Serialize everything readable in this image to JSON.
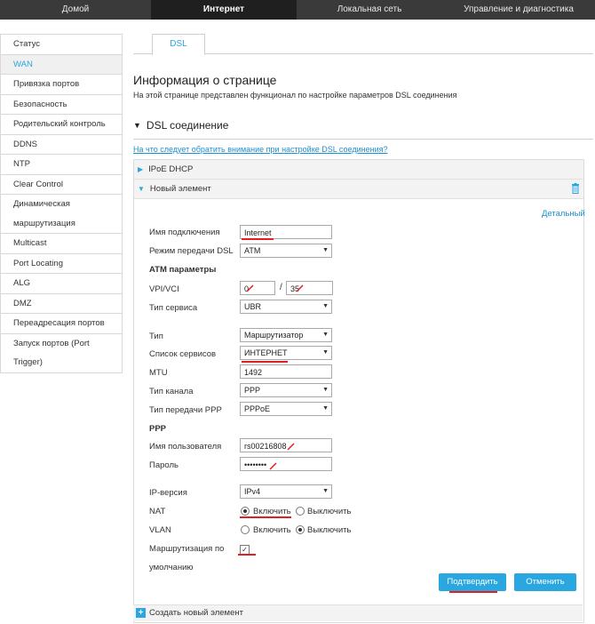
{
  "topnav": [
    "Домой",
    "Интернет",
    "Локальная сеть",
    "Управление и диагностика"
  ],
  "sidebar": [
    "Статус",
    "WAN",
    "Привязка портов",
    "Безопасность",
    "Родительский контроль",
    "DDNS",
    "NTP",
    "Clear Control",
    "Динамическая",
    "маршрутизация",
    "Multicast",
    "Port Locating",
    "ALG",
    "DMZ",
    "Переадресация портов",
    "Запуск портов (Port",
    "Trigger)"
  ],
  "tab": "DSL",
  "page": {
    "title": "Информация о странице",
    "desc": "На этой странице представлен функционал по настройке параметров DSL соединения"
  },
  "section": {
    "title": "DSL соединение",
    "help": "На что следует обратить внимание при настройке DSL соединения?",
    "ipoe": "IPoE DHCP",
    "new_item": "Новый элемент",
    "detail": "Детальный",
    "create": "Создать новый элемент"
  },
  "form": {
    "conn_name_label": "Имя подключения",
    "conn_name": "Internet",
    "mode_label": "Режим передачи DSL",
    "mode": "ATM",
    "atm_header": "ATM параметры",
    "vpivci_label": "VPI/VCI",
    "vpi": "0",
    "vci": "35",
    "svc_type_label": "Тип сервиса",
    "svc_type": "UBR",
    "type_label": "Тип",
    "type": "Маршрутизатор",
    "svc_list_label": "Список сервисов",
    "svc_list": "ИНТЕРНЕТ",
    "mtu_label": "MTU",
    "mtu": "1492",
    "chan_label": "Тип канала",
    "chan": "PPP",
    "ppp_trans_label": "Тип передачи PPP",
    "ppp_trans": "PPPoE",
    "ppp_header": "PPP",
    "user_label": "Имя пользователя",
    "user": "rs00216808",
    "pass_label": "Пароль",
    "pass": "••••••••",
    "ip_label": "IP-версия",
    "ip": "IPv4",
    "nat_label": "NAT",
    "nat_on": "Включить",
    "nat_off": "Выключить",
    "vlan_label": "VLAN",
    "vlan_on": "Включить",
    "vlan_off": "Выключить",
    "route_label1": "Маршрутизация по",
    "route_label2": "умолчанию",
    "confirm": "Подтвердить",
    "cancel": "Отменить"
  }
}
